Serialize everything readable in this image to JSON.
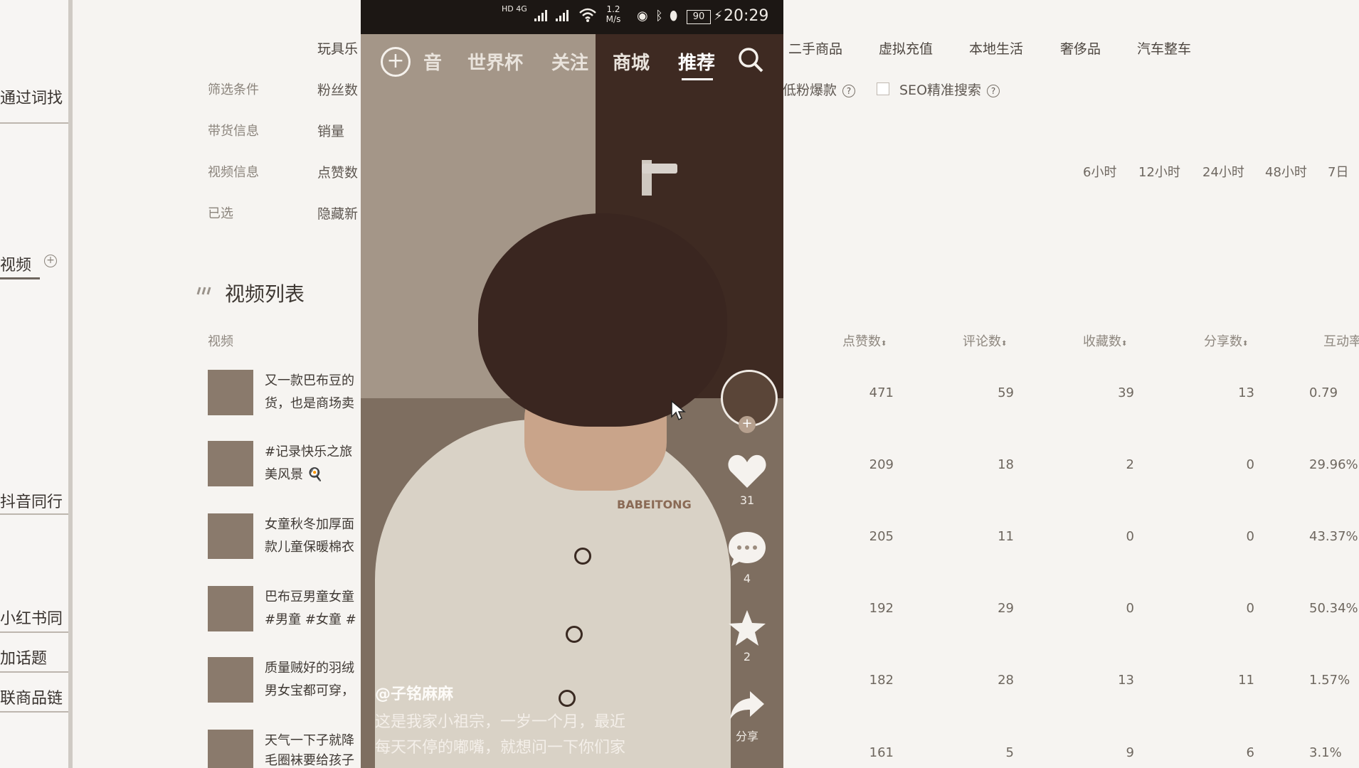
{
  "left_panel": {
    "items": [
      "通过词找",
      "视频",
      "抖音同行",
      "小红书同",
      "加话题",
      "联商品链"
    ]
  },
  "categories": [
    "玩具乐",
    "二手商品",
    "虚拟充值",
    "本地生活",
    "奢侈品",
    "汽车整车"
  ],
  "filters": {
    "rows": [
      {
        "label": "筛选条件",
        "value": "粉丝数"
      },
      {
        "label": "带货信息",
        "value": "销量"
      },
      {
        "label": "视频信息",
        "value": "点赞数"
      },
      {
        "label": "已选",
        "value": "隐藏新"
      }
    ],
    "low_fan_label": "低粉爆款",
    "seo_label": "SEO精准搜索",
    "time_options": [
      "6小时",
      "12小时",
      "24小时",
      "48小时",
      "7日"
    ]
  },
  "section": {
    "title": "视频列表"
  },
  "table": {
    "headers": {
      "video": "视频",
      "likes": "点赞数",
      "comments": "评论数",
      "favorites": "收藏数",
      "shares": "分享数",
      "engagement": "互动率"
    },
    "rows": [
      {
        "line1": "又一款巴布豆的",
        "line2": "货，也是商场卖",
        "likes": "471",
        "comments": "59",
        "favorites": "39",
        "shares": "13",
        "engagement": "0.79"
      },
      {
        "line1": "#记录快乐之旅",
        "line2": "美风景 🍳",
        "likes": "209",
        "comments": "18",
        "favorites": "2",
        "shares": "0",
        "engagement": "29.96%"
      },
      {
        "line1": "女童秋冬加厚面",
        "line2": "款儿童保暖棉衣",
        "likes": "205",
        "comments": "11",
        "favorites": "0",
        "shares": "0",
        "engagement": "43.37%"
      },
      {
        "line1": "巴布豆男童女童",
        "line2": "#男童 #女童 #",
        "likes": "192",
        "comments": "29",
        "favorites": "0",
        "shares": "0",
        "engagement": "50.34%"
      },
      {
        "line1": "质量贼好的羽绒",
        "line2": "男女宝都可穿，",
        "likes": "182",
        "comments": "28",
        "favorites": "13",
        "shares": "11",
        "engagement": "1.57%"
      },
      {
        "line1": "天气一下子就降",
        "line2": "毛圈袜要给孩子",
        "likes": "161",
        "comments": "5",
        "favorites": "9",
        "shares": "6",
        "engagement": "3.1%"
      }
    ]
  },
  "phone": {
    "status": {
      "network": "HD 4G",
      "speed_top": "1.2",
      "speed_bottom": "M/s",
      "battery": "90",
      "time": "20:29"
    },
    "nav": [
      "音",
      "世界杯",
      "关注",
      "商城",
      "推荐"
    ],
    "active_nav": "推荐",
    "side": {
      "likes": "31",
      "comments": "4",
      "favorites": "2",
      "share_label": "分享"
    },
    "author": "@子铭麻麻",
    "caption_line1": "这是我家小祖宗，一岁一个月，最近",
    "caption_line2": "每天不停的嘟嘴，就想问一下你们家",
    "shirt_text": "BABEITONG"
  }
}
